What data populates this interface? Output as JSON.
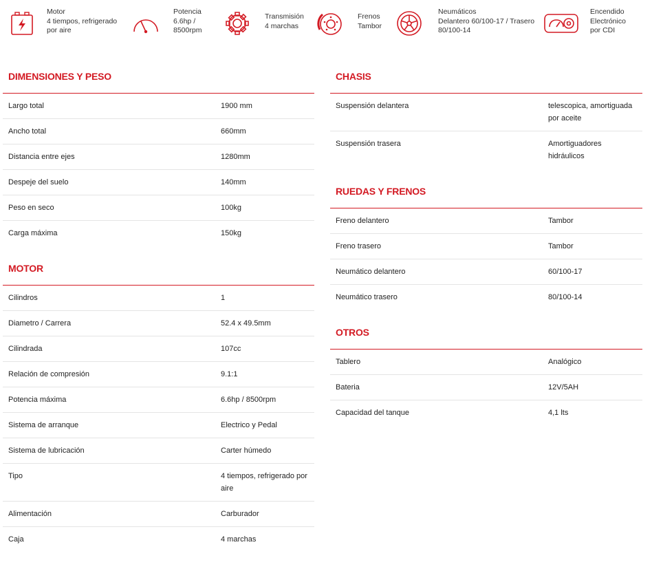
{
  "features": [
    {
      "icon": "battery-bolt-icon",
      "lines": [
        "Motor",
        "4 tiempos, refrigerado",
        "por aire"
      ]
    },
    {
      "icon": "speedometer-icon",
      "lines": [
        "Potencia",
        "6.6hp /",
        "8500rpm"
      ]
    },
    {
      "icon": "gear-icon",
      "lines": [
        "Transmisión",
        "4 marchas"
      ]
    },
    {
      "icon": "brake-disc-icon",
      "lines": [
        "Frenos",
        "Tambor"
      ]
    },
    {
      "icon": "wheel-icon",
      "lines": [
        "Neumáticos",
        "Delantero 60/100-17 / Trasero",
        "80/100-14"
      ]
    },
    {
      "icon": "ignition-key-icon",
      "lines": [
        "Encendido",
        "Electrónico",
        "por CDI"
      ]
    }
  ],
  "accent_color": "#d31a23",
  "sections": {
    "dimensiones": {
      "title": "DIMENSIONES Y PESO",
      "rows": [
        [
          "Largo total",
          "1900 mm"
        ],
        [
          "Ancho total",
          "660mm"
        ],
        [
          "Distancia entre ejes",
          "1280mm"
        ],
        [
          "Despeje del suelo",
          "140mm"
        ],
        [
          "Peso en seco",
          "100kg"
        ],
        [
          "Carga máxima",
          "150kg"
        ]
      ]
    },
    "motor": {
      "title": "MOTOR",
      "rows": [
        [
          "Cilindros",
          "1"
        ],
        [
          "Diametro / Carrera",
          "52.4 x 49.5mm"
        ],
        [
          "Cilindrada",
          "107cc"
        ],
        [
          "Relación de compresión",
          "9.1:1"
        ],
        [
          "Potencia máxima",
          "6.6hp / 8500rpm"
        ],
        [
          "Sistema de arranque",
          "Electrico y Pedal"
        ],
        [
          "Sistema de lubricación",
          "Carter húmedo"
        ],
        [
          "Tipo",
          "4 tiempos, refrigerado por aire"
        ],
        [
          "Alimentación",
          "Carburador"
        ],
        [
          "Caja",
          "4 marchas"
        ]
      ]
    },
    "chasis": {
      "title": "CHASIS",
      "rows": [
        [
          "Suspensión delantera",
          "telescopica, amortiguada por aceite"
        ],
        [
          "Suspensión trasera",
          "Amortiguadores hidráulicos"
        ]
      ]
    },
    "ruedas": {
      "title": "RUEDAS Y FRENOS",
      "rows": [
        [
          "Freno delantero",
          "Tambor"
        ],
        [
          "Freno trasero",
          "Tambor"
        ],
        [
          "Neumático delantero",
          "60/100-17"
        ],
        [
          "Neumático trasero",
          "80/100-14"
        ]
      ]
    },
    "otros": {
      "title": "OTROS",
      "rows": [
        [
          "Tablero",
          "Analógico"
        ],
        [
          "Bateria",
          "12V/5AH"
        ],
        [
          "Capacidad del tanque",
          "4,1 lts"
        ]
      ]
    }
  }
}
